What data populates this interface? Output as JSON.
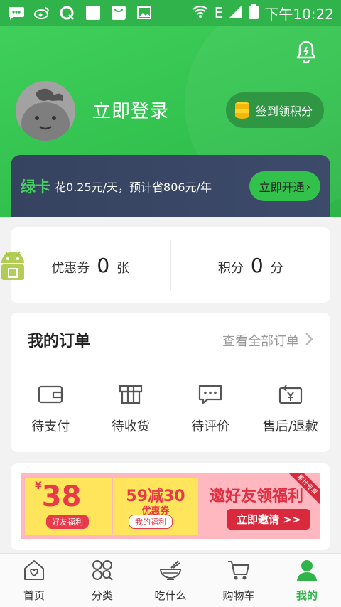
{
  "status_bar": {
    "time": "下午10:22",
    "network": "E",
    "icons": [
      "chat-icon",
      "weibo-icon",
      "q-icon",
      "blank-icon",
      "bag-icon",
      "image-icon"
    ]
  },
  "header": {
    "login_label": "立即登录",
    "checkin_label": "签到领积分"
  },
  "green_card": {
    "title": "绿卡",
    "desc": "花0.25元/天，预计省806元/年",
    "button": "立即开通",
    "arrow": "›"
  },
  "points": {
    "coupon_label": "优惠券",
    "coupon_count": "0",
    "coupon_unit": "张",
    "score_label": "积分",
    "score_count": "0",
    "score_unit": "分"
  },
  "orders": {
    "title": "我的订单",
    "view_all": "查看全部订单",
    "items": [
      {
        "label": "待支付",
        "icon": "wallet-icon"
      },
      {
        "label": "待收货",
        "icon": "package-icon"
      },
      {
        "label": "待评价",
        "icon": "comment-icon"
      },
      {
        "label": "售后/退款",
        "icon": "refund-icon"
      }
    ]
  },
  "banner": {
    "c1_yen": "¥",
    "c1_amount": "38",
    "c1_tag": "好友福利",
    "c2_amount": "59减30",
    "c2_sub": "优惠券",
    "c2_tag": "我的福利",
    "invite_title": "邀好友领福利",
    "invite_button": "立即邀请 >>",
    "ribbon": "累计专享"
  },
  "tabbar": {
    "items": [
      {
        "label": "首页",
        "icon": "home-icon"
      },
      {
        "label": "分类",
        "icon": "category-icon"
      },
      {
        "label": "吃什么",
        "icon": "bowl-icon"
      },
      {
        "label": "购物车",
        "icon": "cart-icon"
      },
      {
        "label": "我的",
        "icon": "user-icon"
      }
    ],
    "active_index": 4
  },
  "colors": {
    "brand_green": "#2fb34a",
    "card_navy": "#354360",
    "accent_red": "#e83a4a"
  }
}
